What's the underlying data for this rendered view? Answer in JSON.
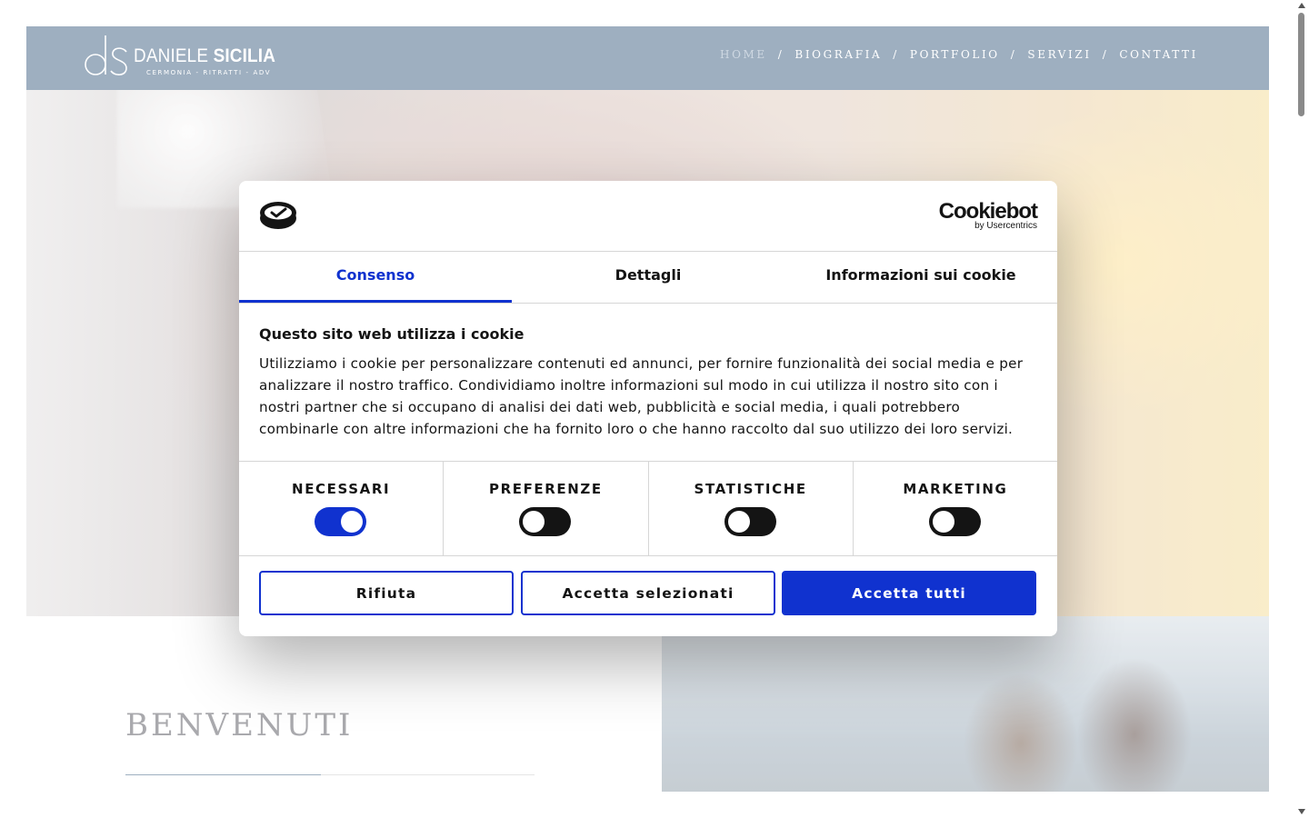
{
  "site": {
    "logo_name_light": "DANIELE ",
    "logo_name_bold": "SICILIA",
    "logo_tagline": "CERMONIA - RITRATTI - ADV",
    "nav": [
      {
        "label": "HOME"
      },
      {
        "label": "BIOGRAFIA"
      },
      {
        "label": "PORTFOLIO"
      },
      {
        "label": "SERVIZI"
      },
      {
        "label": "CONTATTI"
      }
    ],
    "nav_separator": "/",
    "welcome_title": "BENVENUTI",
    "header_color": "#9eafc0"
  },
  "cookie_dialog": {
    "brand": "Cookiebot",
    "brand_sub": "by Usercentrics",
    "tabs": [
      {
        "label": "Consenso"
      },
      {
        "label": "Dettagli"
      },
      {
        "label": "Informazioni sui cookie"
      }
    ],
    "title": "Questo sito web utilizza i cookie",
    "text": "Utilizziamo i cookie per personalizzare contenuti ed annunci, per fornire funzionalità dei social media e per analizzare il nostro traffico. Condividiamo inoltre informazioni sul modo in cui utilizza il nostro sito con i nostri partner che si occupano di analisi dei dati web, pubblicità e social media, i quali potrebbero combinarle con altre informazioni che ha fornito loro o che hanno raccolto dal suo utilizzo dei loro servizi.",
    "categories": [
      {
        "label": "NECESSARI",
        "enabled": true
      },
      {
        "label": "PREFERENZE",
        "enabled": false
      },
      {
        "label": "STATISTICHE",
        "enabled": false
      },
      {
        "label": "MARKETING",
        "enabled": false
      }
    ],
    "buttons": {
      "reject": "Rifiuta",
      "accept_selected": "Accetta selezionati",
      "accept_all": "Accetta tutti"
    },
    "accent_color": "#1032cf"
  }
}
